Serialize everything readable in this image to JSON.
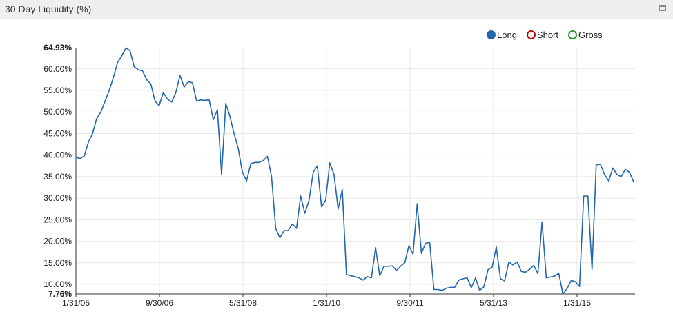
{
  "panel": {
    "title": "30 Day Liquidity (%)",
    "maximize_icon": "maximize-icon"
  },
  "colors": {
    "long": "#2166ac",
    "short": "#c00000",
    "gross": "#2a9a2a",
    "grid": "#e8e8e8",
    "axis": "#333333"
  },
  "chart_data": {
    "type": "line",
    "title": "30 Day Liquidity (%)",
    "xlabel": "",
    "ylabel": "",
    "grid": true,
    "legend": "top-right",
    "ylim": [
      7.76,
      64.93
    ],
    "y_ticks": [
      "10.00%",
      "15.00%",
      "20.00%",
      "25.00%",
      "30.00%",
      "35.00%",
      "40.00%",
      "45.00%",
      "50.00%",
      "55.00%",
      "60.00%"
    ],
    "y_min_label": "7.76%",
    "y_max_label": "64.93%",
    "x_ticks": [
      "1/31/05",
      "9/30/06",
      "5/31/08",
      "1/31/10",
      "9/30/11",
      "5/31/13",
      "1/31/15"
    ],
    "series": [
      {
        "name": "Long",
        "legend_style": "filled",
        "values": [
          39.5,
          39.2,
          39.8,
          43.0,
          45.0,
          48.5,
          50.0,
          52.5,
          55.0,
          58.0,
          61.5,
          63.0,
          64.9,
          64.2,
          60.5,
          59.8,
          59.5,
          57.5,
          56.5,
          52.5,
          51.5,
          54.5,
          53.0,
          52.3,
          54.5,
          58.5,
          55.8,
          57.0,
          56.8,
          52.5,
          52.8,
          52.7,
          52.8,
          48.2,
          50.5,
          35.5,
          52.0,
          49.0,
          45.0,
          41.5,
          36.0,
          34.0,
          38.0,
          38.3,
          38.3,
          38.7,
          39.7,
          35.0,
          23.0,
          20.8,
          22.5,
          22.5,
          24.0,
          23.0,
          30.5,
          26.5,
          29.5,
          36.0,
          37.5,
          28.0,
          29.5,
          38.2,
          35.5,
          27.5,
          32.0,
          12.3,
          12.0,
          11.8,
          11.5,
          11.0,
          11.8,
          11.5,
          18.5,
          12.0,
          14.2,
          14.2,
          14.3,
          13.2,
          14.2,
          15.0,
          19.0,
          17.0,
          28.7,
          17.2,
          19.5,
          19.8,
          8.8,
          8.8,
          8.6,
          9.1,
          9.3,
          9.3,
          11.0,
          11.3,
          11.5,
          9.2,
          11.5,
          8.6,
          9.4,
          13.4,
          14.0,
          18.7,
          11.3,
          10.8,
          15.2,
          14.5,
          15.2,
          13.0,
          12.8,
          13.5,
          14.4,
          12.5,
          24.5,
          11.5,
          11.7,
          11.9,
          12.6,
          7.76,
          9.0,
          10.9,
          10.6,
          9.5,
          30.5,
          30.5,
          13.5,
          37.7,
          37.9,
          35.5,
          34.0,
          37.0,
          35.5,
          35.0,
          36.7,
          36.0,
          33.8
        ]
      },
      {
        "name": "Short",
        "legend_style": "hollow",
        "values": []
      },
      {
        "name": "Gross",
        "legend_style": "hollow",
        "values": []
      }
    ]
  }
}
